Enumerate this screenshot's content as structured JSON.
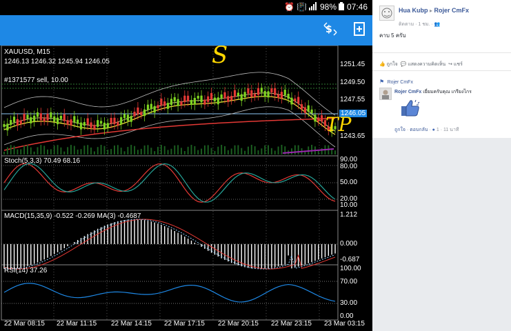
{
  "status_bar": {
    "battery": "98%",
    "time": "07:46"
  },
  "toolbar": {
    "icons": [
      "currency-exchange-icon",
      "add-document-icon"
    ]
  },
  "chart": {
    "symbol": "XAUUSD, M15",
    "ohlc": "1246.13 1246.32 1245.94 1246.05",
    "order": "#1371577 sell, 10.00",
    "price_axis": [
      "1251.45",
      "1249.50",
      "1247.55",
      "1243.65"
    ],
    "current_price": "1246.05",
    "stoch_label": "Stoch(5,3,3) 70.49 68.16",
    "stoch_axis": [
      "90.00",
      "80.00",
      "50.00",
      "20.00",
      "10.00"
    ],
    "macd_label": "MACD(15,35,9) -0.522 -0.269 MA(3) -0.4687",
    "macd_axis": [
      "1.212",
      "0.000",
      "-0.687"
    ],
    "rsi_label": "RSI(14) 37.26",
    "rsi_axis": [
      "100.00",
      "70.00",
      "30.00",
      "0.00"
    ],
    "time_axis": [
      "22 Mar 08:15",
      "22 Mar 11:15",
      "22 Mar 14:15",
      "22 Mar 17:15",
      "22 Mar 20:15",
      "22 Mar 23:15",
      "23 Mar 03:15"
    ],
    "annotation_s": "S",
    "annotation_tp": "TP",
    "colors": {
      "bull_candle": "#7ed321",
      "bear_candle": "#e53935",
      "ma_slow": "#e53935",
      "ma_fast": "#ffeb3b",
      "bands": "#bdbdbd",
      "stoch_main": "#e53935",
      "stoch_signal": "#26a69a",
      "rsi": "#1e88e5",
      "app_bar": "#1e88e5"
    }
  },
  "facebook": {
    "post_author": "Hua Kubp",
    "post_target": "Rojer CmFx",
    "post_meta": "ติดตาม · 1 ชม. · ",
    "post_text": "คาบ 5 ครับ",
    "like": "ถูกใจ",
    "show_comments": "แสดงความคิดเห็น",
    "share": "แชร์",
    "page_label": "Rojer CmFx",
    "comment_author": "Rojer CmFx",
    "comment_text": "เยี่ยมครับคุณ เกรียงไกร",
    "comment_like": "ถูกใจ",
    "comment_reply": "ตอบกลับ",
    "comment_likes": "1",
    "comment_time": "11 นาที"
  }
}
